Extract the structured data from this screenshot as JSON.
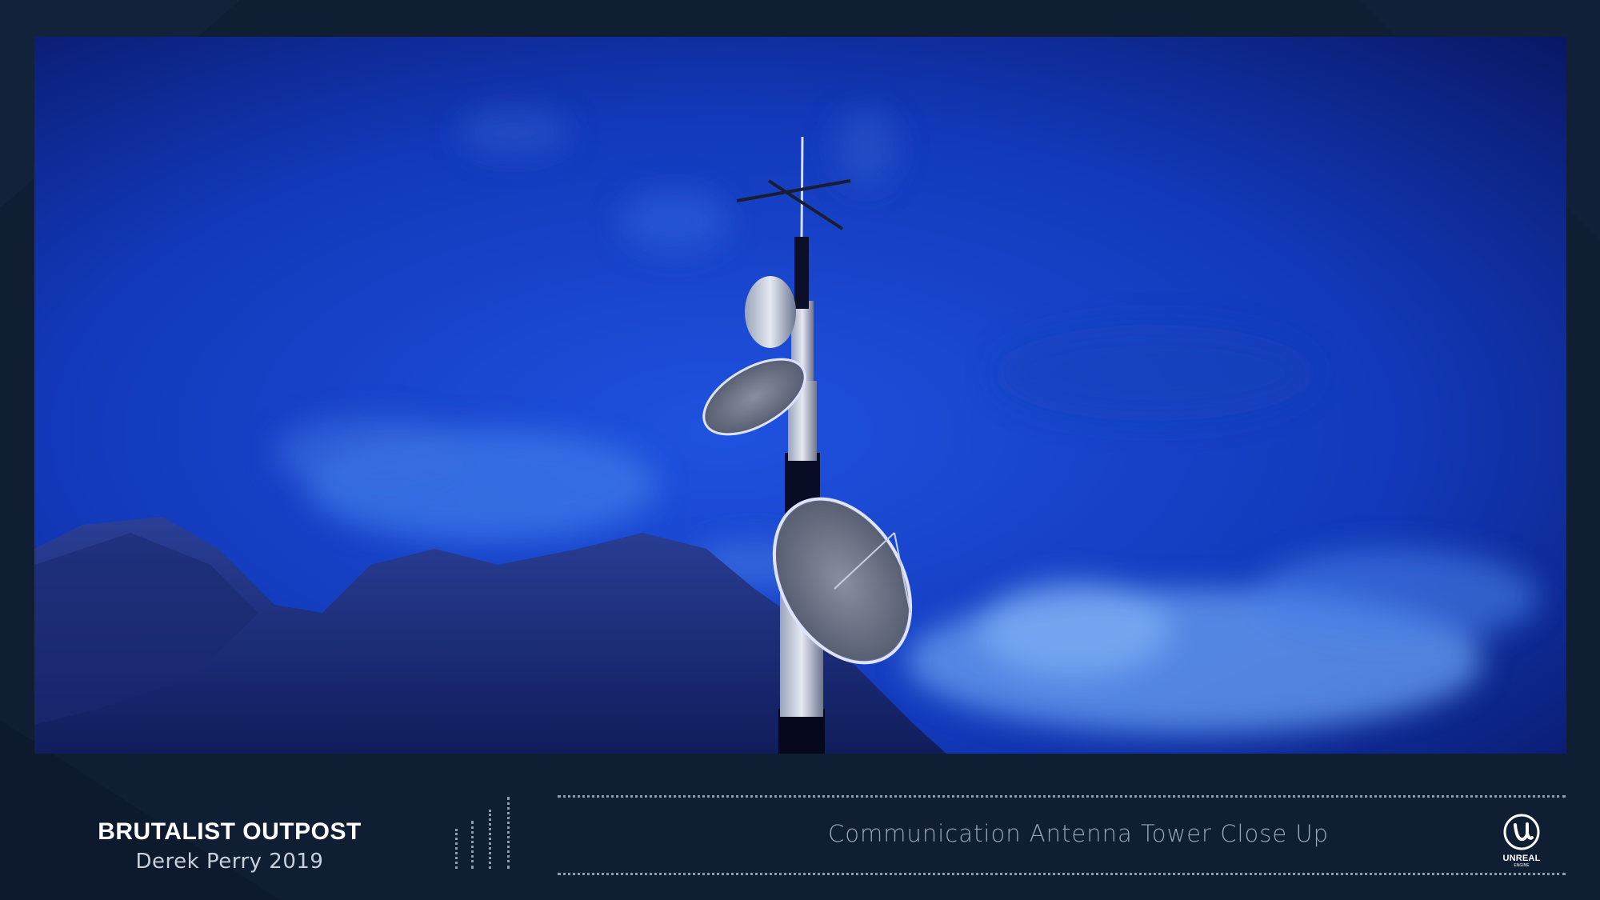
{
  "project": {
    "title": "BRUTALIST OUTPOST",
    "author": "Derek Perry 2019"
  },
  "caption": "Communication Antenna Tower Close Up",
  "logo": {
    "icon": "unreal-engine-logo",
    "text": "UNREAL",
    "subtext": "ENGINE"
  },
  "colors": {
    "background": "#0f1e33",
    "sky": "#0b2aa8",
    "accent": "#ffffff"
  }
}
